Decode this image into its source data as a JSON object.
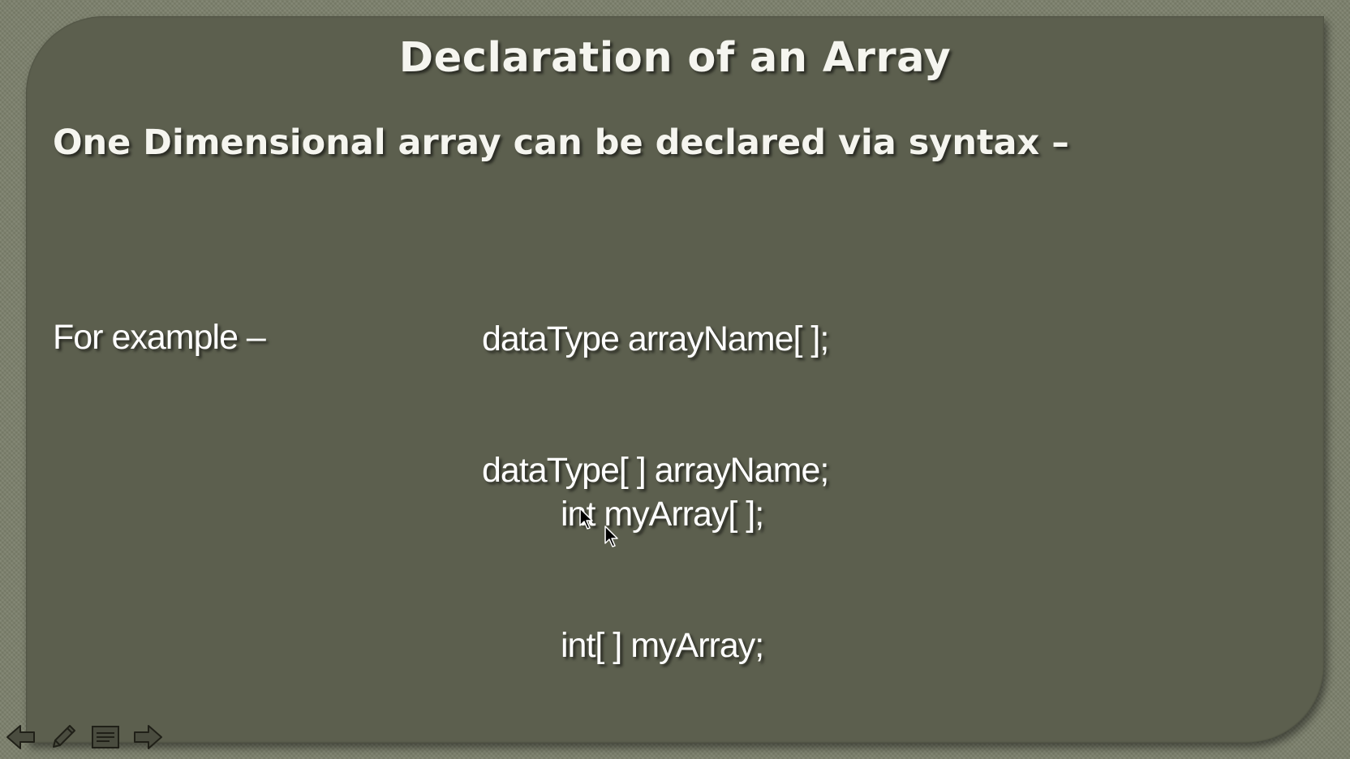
{
  "slide": {
    "title": "Declaration of an Array",
    "subheading": "One Dimensional array can be declared via syntax –",
    "syntax_lines": [
      "dataType arrayName[ ];",
      "dataType[ ] arrayName;"
    ],
    "example_label": "For example –",
    "example_lines": [
      "int myArray[ ];",
      "int[ ] myArray;"
    ]
  },
  "navigation": {
    "buttons": [
      {
        "name": "previous-slide-button",
        "icon": "arrow-left-icon"
      },
      {
        "name": "pen-tool-button",
        "icon": "pencil-icon"
      },
      {
        "name": "slide-menu-button",
        "icon": "menu-icon"
      },
      {
        "name": "next-slide-button",
        "icon": "arrow-right-icon"
      }
    ]
  },
  "colors": {
    "background": "#7c806c",
    "slide_panel": "#5c5f4e",
    "text": "#f5f5ef"
  }
}
